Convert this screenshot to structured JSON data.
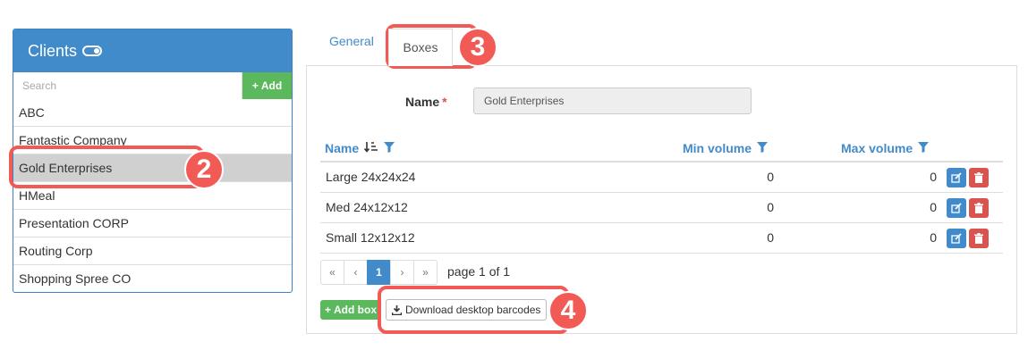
{
  "clients": {
    "title": "Clients",
    "search_placeholder": "Search",
    "add_label": "Add",
    "items": [
      "ABC",
      "Fantastic Company",
      "Gold Enterprises",
      "HMeal",
      "Presentation CORP",
      "Routing Corp",
      "Shopping Spree CO"
    ],
    "selected": "Gold Enterprises"
  },
  "tabs": {
    "general": "General",
    "boxes": "Boxes",
    "active": "Boxes"
  },
  "form": {
    "name_label": "Name",
    "required_mark": "*",
    "name_value": "Gold Enterprises"
  },
  "grid": {
    "headers": {
      "name": "Name",
      "min": "Min volume",
      "max": "Max volume"
    },
    "rows": [
      {
        "name": "Large 24x24x24",
        "min": "0",
        "max": "0"
      },
      {
        "name": "Med 24x12x12",
        "min": "0",
        "max": "0"
      },
      {
        "name": "Small 12x12x12",
        "min": "0",
        "max": "0"
      }
    ]
  },
  "pager": {
    "first": "«",
    "prev": "‹",
    "current": "1",
    "next": "›",
    "last": "»",
    "info": "page 1 of 1"
  },
  "buttons": {
    "add_box": "Add box",
    "download": "Download desktop barcodes"
  },
  "annotations": [
    "2",
    "3",
    "4"
  ],
  "colors": {
    "primary": "#428bca",
    "success": "#5cb85c",
    "danger": "#d9534f",
    "highlight": "#f25a55"
  }
}
